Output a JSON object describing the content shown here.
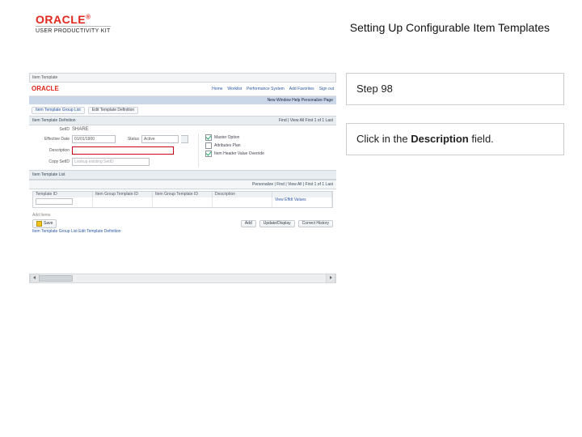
{
  "header": {
    "brand": "ORACLE",
    "brand_sub": "USER PRODUCTIVITY KIT",
    "title": "Setting Up Configurable Item Templates"
  },
  "instruction": {
    "step": "Step 98",
    "line_pre": "Click in the ",
    "line_bold": "Description",
    "line_post": " field."
  },
  "shot": {
    "browser_tab": "Item Template",
    "oracle": "ORACLE",
    "nav": [
      "Home",
      "Worklist",
      "Performance System",
      "Add Favorites",
      "Sign out"
    ],
    "bluebar_right": "New Window   Help   Personalize Page",
    "crumb1": "Item Template Group List",
    "crumb2": "Edit Template Definition",
    "section1_title": "Item Template Definition",
    "pager1": "Find | View All   First  1 of 1  Last",
    "setid_lbl": "SetID",
    "setid_val": "SHARE",
    "desc_lbl": "Description",
    "effdate_lbl": "Effective Date",
    "effdate_val": "01/01/1900",
    "status_lbl": "Status",
    "status_val": "Active",
    "copy_from_lbl": "Copy SetID",
    "copy_from_placeholder": "Lookup existing SetID",
    "opt_master": "Master Option",
    "opt_attr": "Attributes Plan",
    "opt_override": "Item Header Value Override",
    "list_label": "Item Template List",
    "pager2": "Personalize | Find | View All |   First  1 of 1  Last",
    "grid_headers": [
      "Template ID",
      "Item Group Template ID",
      "Item Group Template ID",
      "Description",
      ""
    ],
    "grid_link": "View Effdt Values",
    "bottom_label": "Add Items",
    "btn_save": "Save",
    "btn_add": "Add",
    "btn_update": "Update/Display",
    "btn_correct": "Correct History",
    "footer_links": "Item Template Group List   Edit Template Definition"
  }
}
